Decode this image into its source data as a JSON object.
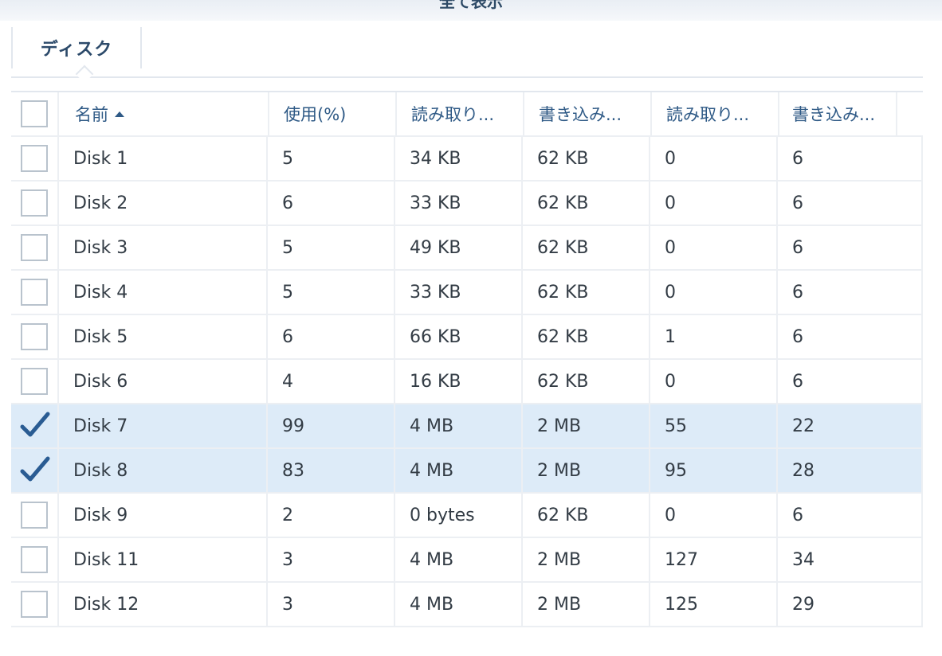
{
  "header": {
    "title": "全て表示"
  },
  "tabs": [
    {
      "label": "ディスク"
    }
  ],
  "table": {
    "columns": [
      "名前",
      "使用(%)",
      "読み取り...",
      "書き込み...",
      "読み取り...",
      "書き込み..."
    ],
    "sort": {
      "column": "名前",
      "direction": "asc"
    },
    "rows": [
      {
        "selected": false,
        "cells": [
          "Disk 1",
          "5",
          "34 KB",
          "62 KB",
          "0",
          "6"
        ]
      },
      {
        "selected": false,
        "cells": [
          "Disk 2",
          "6",
          "33 KB",
          "62 KB",
          "0",
          "6"
        ]
      },
      {
        "selected": false,
        "cells": [
          "Disk 3",
          "5",
          "49 KB",
          "62 KB",
          "0",
          "6"
        ]
      },
      {
        "selected": false,
        "cells": [
          "Disk 4",
          "5",
          "33 KB",
          "62 KB",
          "0",
          "6"
        ]
      },
      {
        "selected": false,
        "cells": [
          "Disk 5",
          "6",
          "66 KB",
          "62 KB",
          "1",
          "6"
        ]
      },
      {
        "selected": false,
        "cells": [
          "Disk 6",
          "4",
          "16 KB",
          "62 KB",
          "0",
          "6"
        ]
      },
      {
        "selected": true,
        "cells": [
          "Disk 7",
          "99",
          "4 MB",
          "2 MB",
          "55",
          "22"
        ]
      },
      {
        "selected": true,
        "cells": [
          "Disk 8",
          "83",
          "4 MB",
          "2 MB",
          "95",
          "28"
        ]
      },
      {
        "selected": false,
        "cells": [
          "Disk 9",
          "2",
          "0 bytes",
          "62 KB",
          "0",
          "6"
        ]
      },
      {
        "selected": false,
        "cells": [
          "Disk 11",
          "3",
          "4 MB",
          "2 MB",
          "127",
          "34"
        ]
      },
      {
        "selected": false,
        "cells": [
          "Disk 12",
          "3",
          "4 MB",
          "2 MB",
          "125",
          "29"
        ]
      }
    ]
  },
  "colors": {
    "accent": "#2f5a86",
    "selected_row": "#ddebf8",
    "checkmark": "#2a5c93"
  }
}
